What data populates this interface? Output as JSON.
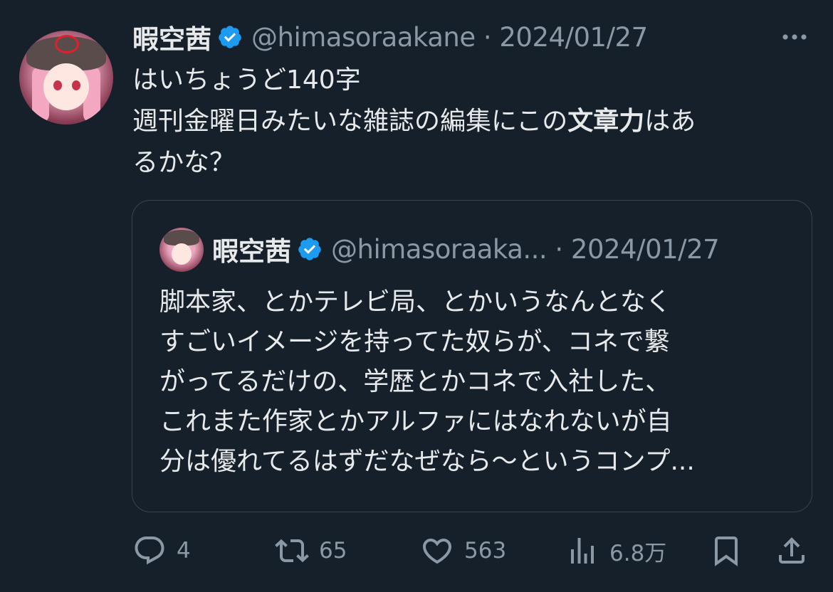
{
  "tweet": {
    "author_name": "暇空茜",
    "handle_date": "@himasoraakane · 2024/01/27",
    "text_line1": "はいちょうど140字",
    "text_line2_pre": "週刊金曜日みたいな雑誌の編集にこの",
    "text_line2_bold": "文章力",
    "text_line2_post": "はあ",
    "text_line3": "るかな？"
  },
  "quote": {
    "author_name": "暇空茜",
    "handle_date": "@himasoraaka... · 2024/01/27",
    "lines": [
      "脚本家、とかテレビ局、とかいうなんとなく",
      "すごいイメージを持ってた奴らが、コネで繋",
      "がってるだけの、学歴とかコネで入社した、",
      "これまた作家とかアルファにはなれないが自",
      "分は優れてるはずだなぜなら〜というコンプ..."
    ]
  },
  "actions": {
    "replies": "4",
    "retweets": "65",
    "likes": "563",
    "views": "6.8万"
  },
  "icons": {
    "verified": "verified-badge-icon",
    "more": "more-dots-icon",
    "reply": "reply-icon",
    "retweet": "retweet-icon",
    "like": "heart-icon",
    "views": "views-icon",
    "bookmark": "bookmark-icon",
    "share": "share-icon"
  },
  "colors": {
    "background": "#15202b",
    "text": "#e7e9ea",
    "secondary": "#8b98a5",
    "verified": "#1d9bf0",
    "border": "#38444d"
  }
}
